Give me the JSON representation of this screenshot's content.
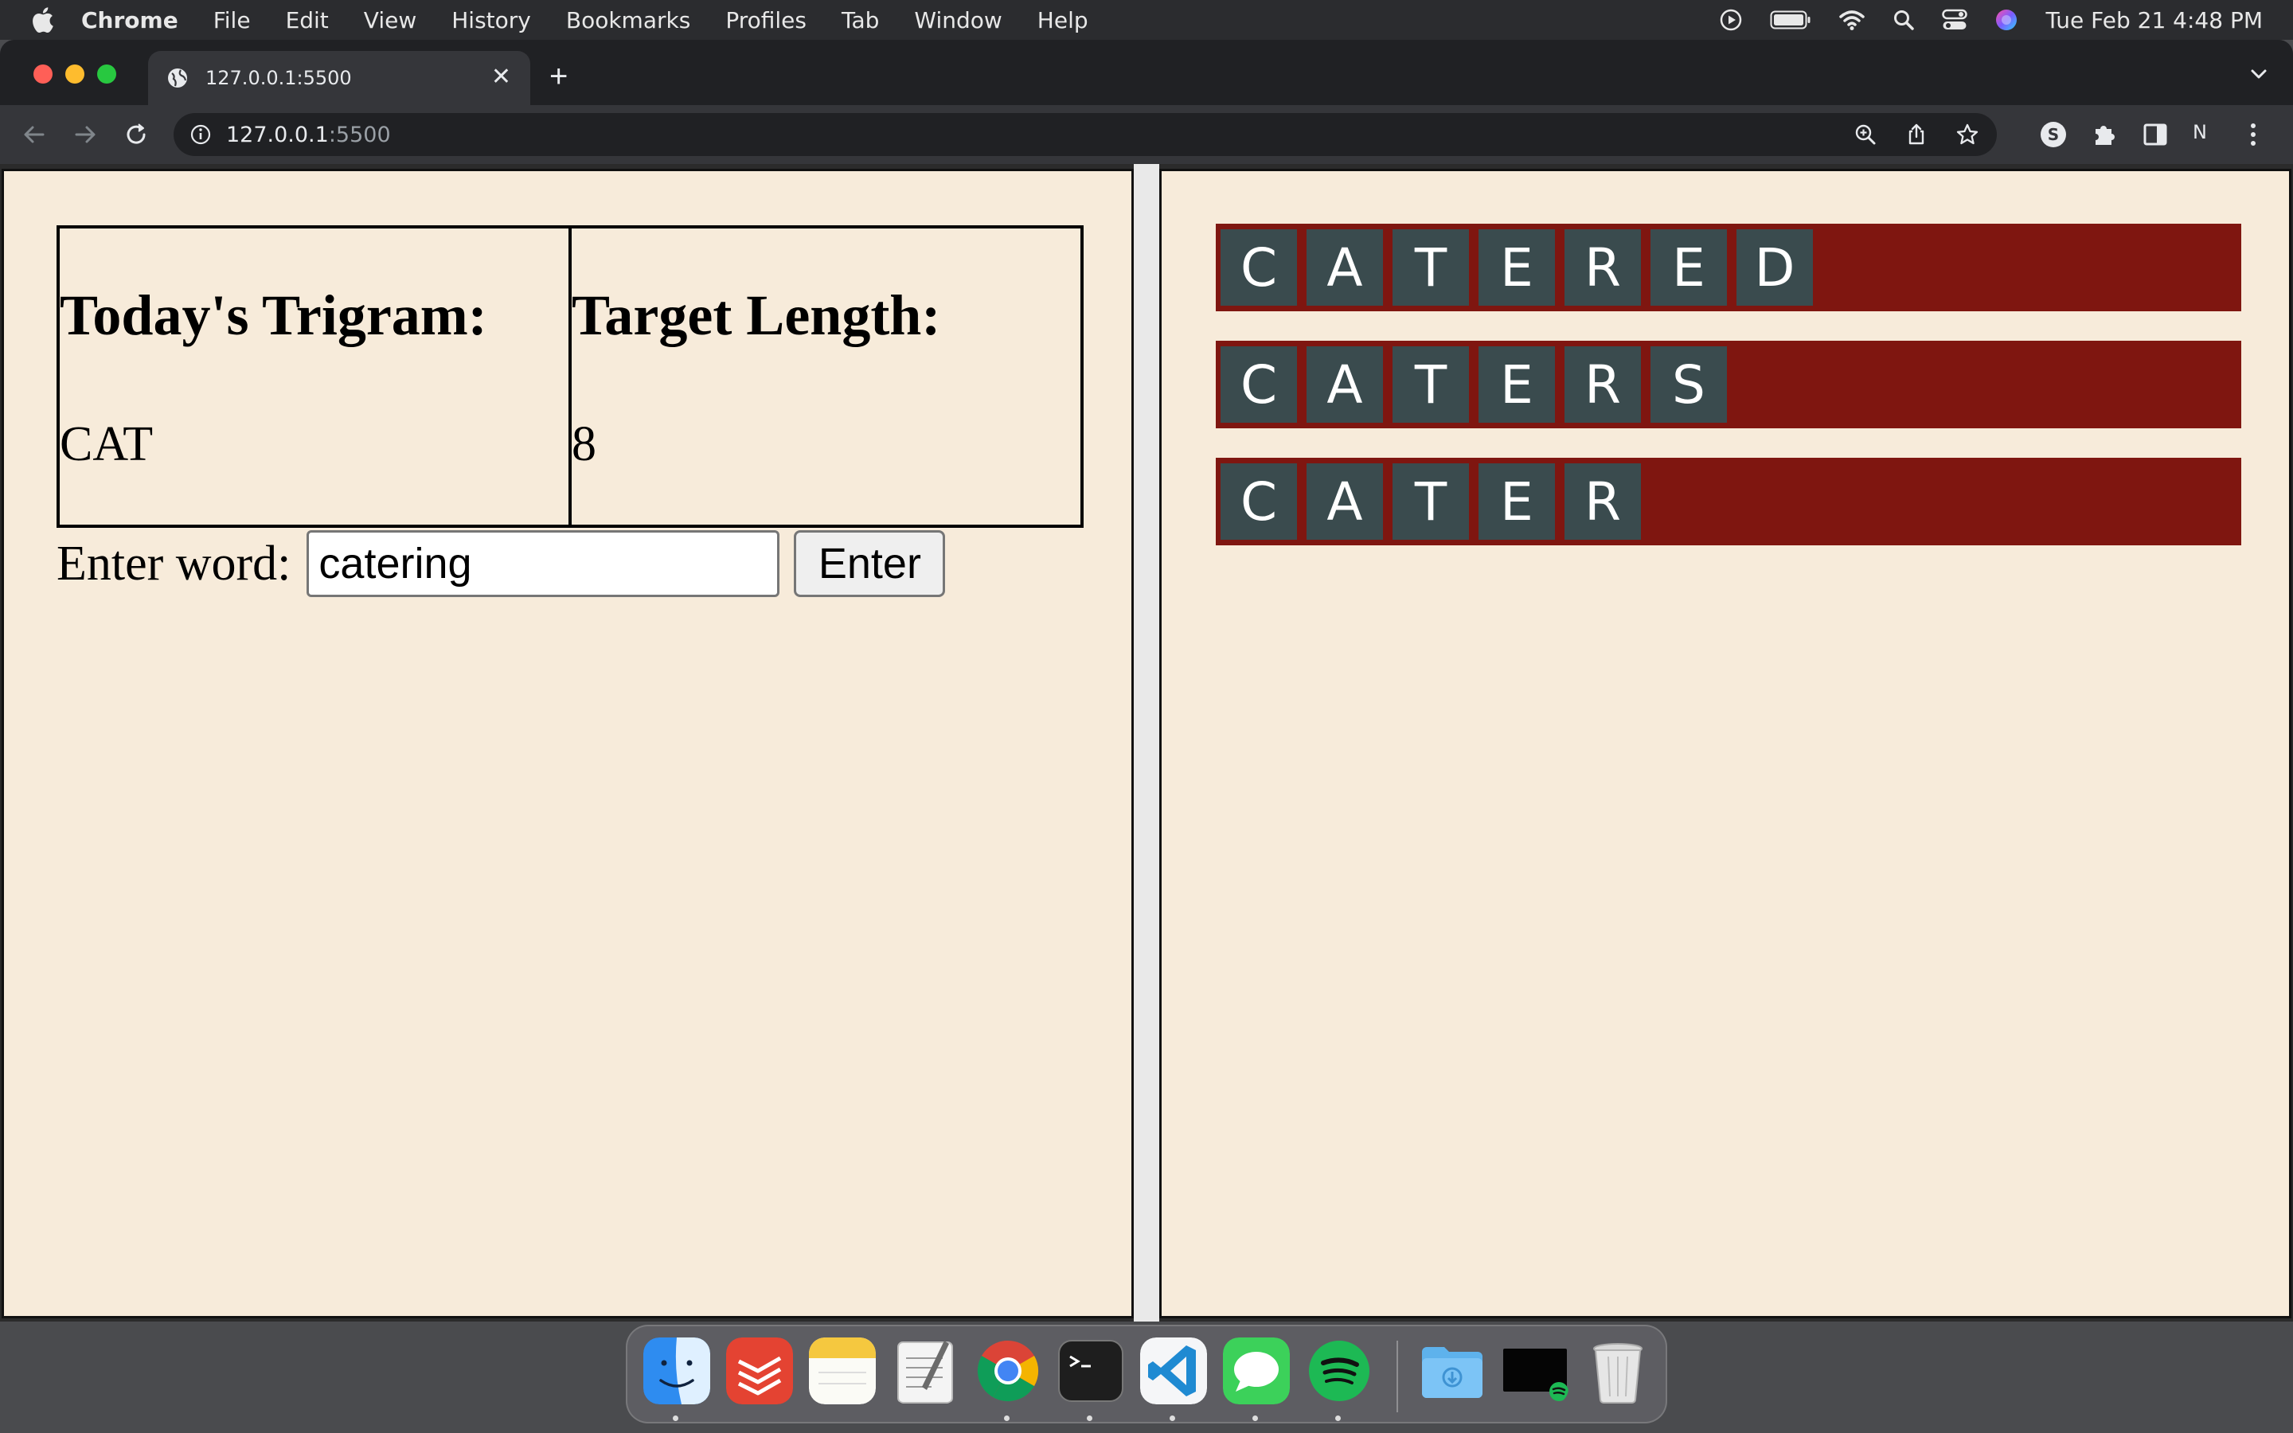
{
  "menubar": {
    "app_name": "Chrome",
    "items": [
      "File",
      "Edit",
      "View",
      "History",
      "Bookmarks",
      "Profiles",
      "Tab",
      "Window",
      "Help"
    ],
    "clock": "Tue Feb 21  4:48 PM"
  },
  "browser": {
    "tab_title": "127.0.0.1:5500",
    "url_host": "127.0.0.1",
    "url_port": ":5500",
    "profile_initial": "N"
  },
  "game": {
    "trigram_label": "Today's Trigram:",
    "trigram_value": "CAT",
    "target_label": "Target Length:",
    "target_value": "8",
    "entry_label": "Enter word:",
    "entry_value": "catering",
    "enter_button": "Enter",
    "guesses": [
      [
        "C",
        "A",
        "T",
        "E",
        "R",
        "E",
        "D"
      ],
      [
        "C",
        "A",
        "T",
        "E",
        "R",
        "S"
      ],
      [
        "C",
        "A",
        "T",
        "E",
        "R"
      ]
    ]
  },
  "dock": {
    "apps": [
      "finder",
      "todoist",
      "notes",
      "textedit",
      "chrome",
      "terminal",
      "vscode",
      "messages",
      "spotify",
      "downloads",
      "screen-recording",
      "trash"
    ]
  }
}
